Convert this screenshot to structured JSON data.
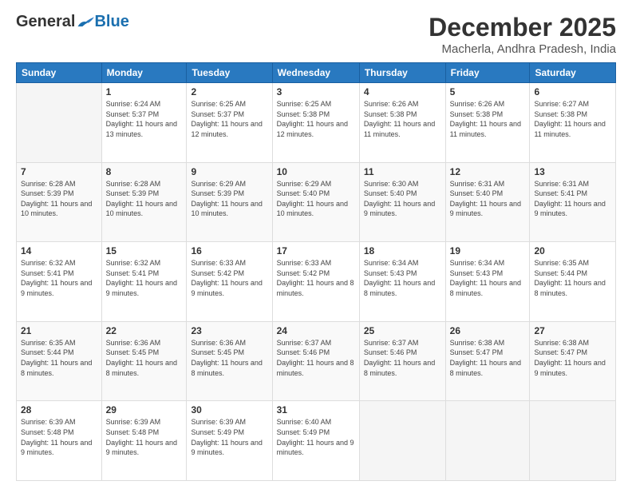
{
  "logo": {
    "general": "General",
    "blue": "Blue"
  },
  "title": "December 2025",
  "location": "Macherla, Andhra Pradesh, India",
  "days_header": [
    "Sunday",
    "Monday",
    "Tuesday",
    "Wednesday",
    "Thursday",
    "Friday",
    "Saturday"
  ],
  "weeks": [
    [
      {
        "day": "",
        "sunrise": "",
        "sunset": "",
        "daylight": ""
      },
      {
        "day": "1",
        "sunrise": "Sunrise: 6:24 AM",
        "sunset": "Sunset: 5:37 PM",
        "daylight": "Daylight: 11 hours and 13 minutes."
      },
      {
        "day": "2",
        "sunrise": "Sunrise: 6:25 AM",
        "sunset": "Sunset: 5:37 PM",
        "daylight": "Daylight: 11 hours and 12 minutes."
      },
      {
        "day": "3",
        "sunrise": "Sunrise: 6:25 AM",
        "sunset": "Sunset: 5:38 PM",
        "daylight": "Daylight: 11 hours and 12 minutes."
      },
      {
        "day": "4",
        "sunrise": "Sunrise: 6:26 AM",
        "sunset": "Sunset: 5:38 PM",
        "daylight": "Daylight: 11 hours and 11 minutes."
      },
      {
        "day": "5",
        "sunrise": "Sunrise: 6:26 AM",
        "sunset": "Sunset: 5:38 PM",
        "daylight": "Daylight: 11 hours and 11 minutes."
      },
      {
        "day": "6",
        "sunrise": "Sunrise: 6:27 AM",
        "sunset": "Sunset: 5:38 PM",
        "daylight": "Daylight: 11 hours and 11 minutes."
      }
    ],
    [
      {
        "day": "7",
        "sunrise": "Sunrise: 6:28 AM",
        "sunset": "Sunset: 5:39 PM",
        "daylight": "Daylight: 11 hours and 10 minutes."
      },
      {
        "day": "8",
        "sunrise": "Sunrise: 6:28 AM",
        "sunset": "Sunset: 5:39 PM",
        "daylight": "Daylight: 11 hours and 10 minutes."
      },
      {
        "day": "9",
        "sunrise": "Sunrise: 6:29 AM",
        "sunset": "Sunset: 5:39 PM",
        "daylight": "Daylight: 11 hours and 10 minutes."
      },
      {
        "day": "10",
        "sunrise": "Sunrise: 6:29 AM",
        "sunset": "Sunset: 5:40 PM",
        "daylight": "Daylight: 11 hours and 10 minutes."
      },
      {
        "day": "11",
        "sunrise": "Sunrise: 6:30 AM",
        "sunset": "Sunset: 5:40 PM",
        "daylight": "Daylight: 11 hours and 9 minutes."
      },
      {
        "day": "12",
        "sunrise": "Sunrise: 6:31 AM",
        "sunset": "Sunset: 5:40 PM",
        "daylight": "Daylight: 11 hours and 9 minutes."
      },
      {
        "day": "13",
        "sunrise": "Sunrise: 6:31 AM",
        "sunset": "Sunset: 5:41 PM",
        "daylight": "Daylight: 11 hours and 9 minutes."
      }
    ],
    [
      {
        "day": "14",
        "sunrise": "Sunrise: 6:32 AM",
        "sunset": "Sunset: 5:41 PM",
        "daylight": "Daylight: 11 hours and 9 minutes."
      },
      {
        "day": "15",
        "sunrise": "Sunrise: 6:32 AM",
        "sunset": "Sunset: 5:41 PM",
        "daylight": "Daylight: 11 hours and 9 minutes."
      },
      {
        "day": "16",
        "sunrise": "Sunrise: 6:33 AM",
        "sunset": "Sunset: 5:42 PM",
        "daylight": "Daylight: 11 hours and 9 minutes."
      },
      {
        "day": "17",
        "sunrise": "Sunrise: 6:33 AM",
        "sunset": "Sunset: 5:42 PM",
        "daylight": "Daylight: 11 hours and 8 minutes."
      },
      {
        "day": "18",
        "sunrise": "Sunrise: 6:34 AM",
        "sunset": "Sunset: 5:43 PM",
        "daylight": "Daylight: 11 hours and 8 minutes."
      },
      {
        "day": "19",
        "sunrise": "Sunrise: 6:34 AM",
        "sunset": "Sunset: 5:43 PM",
        "daylight": "Daylight: 11 hours and 8 minutes."
      },
      {
        "day": "20",
        "sunrise": "Sunrise: 6:35 AM",
        "sunset": "Sunset: 5:44 PM",
        "daylight": "Daylight: 11 hours and 8 minutes."
      }
    ],
    [
      {
        "day": "21",
        "sunrise": "Sunrise: 6:35 AM",
        "sunset": "Sunset: 5:44 PM",
        "daylight": "Daylight: 11 hours and 8 minutes."
      },
      {
        "day": "22",
        "sunrise": "Sunrise: 6:36 AM",
        "sunset": "Sunset: 5:45 PM",
        "daylight": "Daylight: 11 hours and 8 minutes."
      },
      {
        "day": "23",
        "sunrise": "Sunrise: 6:36 AM",
        "sunset": "Sunset: 5:45 PM",
        "daylight": "Daylight: 11 hours and 8 minutes."
      },
      {
        "day": "24",
        "sunrise": "Sunrise: 6:37 AM",
        "sunset": "Sunset: 5:46 PM",
        "daylight": "Daylight: 11 hours and 8 minutes."
      },
      {
        "day": "25",
        "sunrise": "Sunrise: 6:37 AM",
        "sunset": "Sunset: 5:46 PM",
        "daylight": "Daylight: 11 hours and 8 minutes."
      },
      {
        "day": "26",
        "sunrise": "Sunrise: 6:38 AM",
        "sunset": "Sunset: 5:47 PM",
        "daylight": "Daylight: 11 hours and 8 minutes."
      },
      {
        "day": "27",
        "sunrise": "Sunrise: 6:38 AM",
        "sunset": "Sunset: 5:47 PM",
        "daylight": "Daylight: 11 hours and 9 minutes."
      }
    ],
    [
      {
        "day": "28",
        "sunrise": "Sunrise: 6:39 AM",
        "sunset": "Sunset: 5:48 PM",
        "daylight": "Daylight: 11 hours and 9 minutes."
      },
      {
        "day": "29",
        "sunrise": "Sunrise: 6:39 AM",
        "sunset": "Sunset: 5:48 PM",
        "daylight": "Daylight: 11 hours and 9 minutes."
      },
      {
        "day": "30",
        "sunrise": "Sunrise: 6:39 AM",
        "sunset": "Sunset: 5:49 PM",
        "daylight": "Daylight: 11 hours and 9 minutes."
      },
      {
        "day": "31",
        "sunrise": "Sunrise: 6:40 AM",
        "sunset": "Sunset: 5:49 PM",
        "daylight": "Daylight: 11 hours and 9 minutes."
      },
      {
        "day": "",
        "sunrise": "",
        "sunset": "",
        "daylight": ""
      },
      {
        "day": "",
        "sunrise": "",
        "sunset": "",
        "daylight": ""
      },
      {
        "day": "",
        "sunrise": "",
        "sunset": "",
        "daylight": ""
      }
    ]
  ]
}
